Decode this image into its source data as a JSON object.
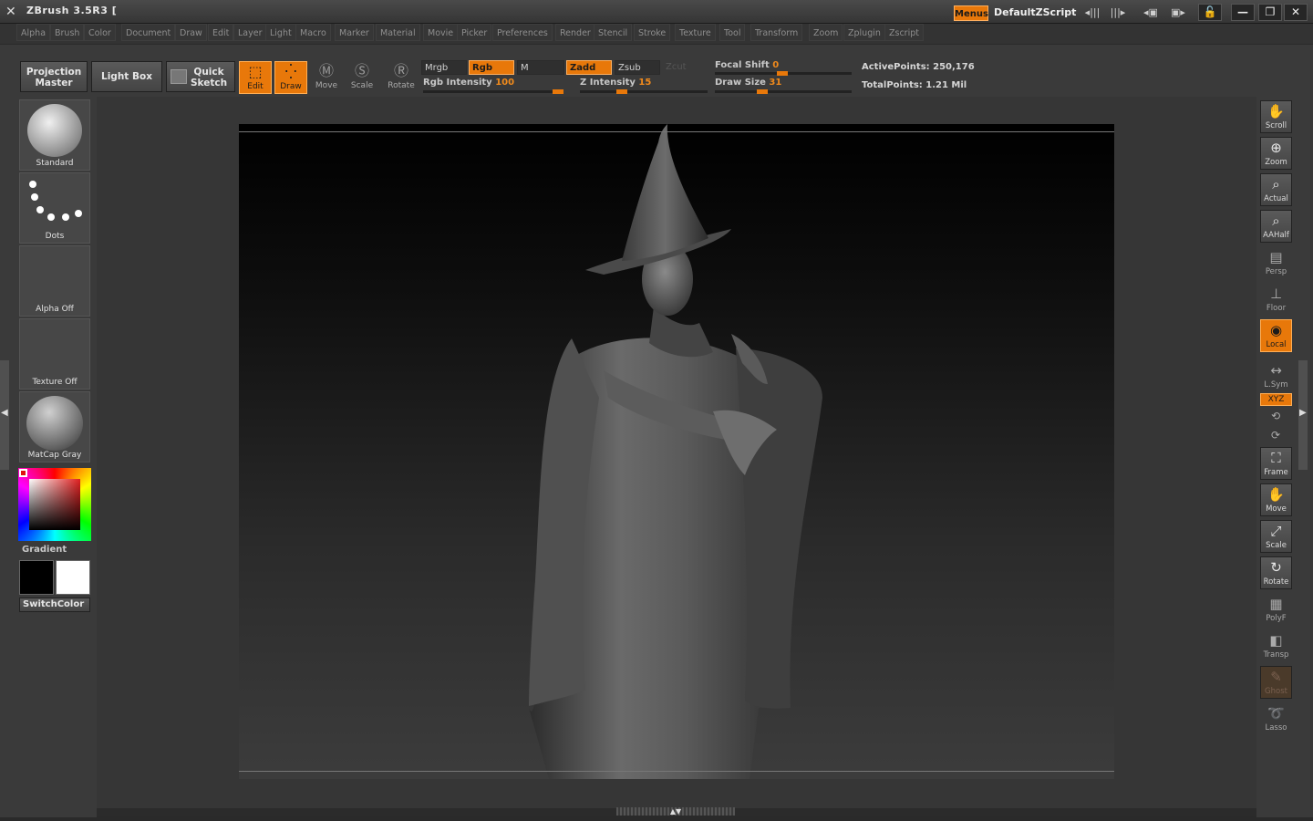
{
  "app": {
    "title": "ZBrush 3.5R3 ["
  },
  "titlebar": {
    "menus_label": "Menus",
    "script_name": "DefaultZScript"
  },
  "menubar": [
    "Alpha",
    "Brush",
    "Color",
    "Document",
    "Draw",
    "Edit",
    "Layer",
    "Light",
    "Macro",
    "Marker",
    "Material",
    "Movie",
    "Picker",
    "Preferences",
    "Render",
    "Stencil",
    "Stroke",
    "Texture",
    "Tool",
    "Transform",
    "Zoom",
    "Zplugin",
    "Zscript"
  ],
  "toolbar": {
    "projection_master_l1": "Projection",
    "projection_master_l2": "Master",
    "light_box": "Light Box",
    "quick_sketch_l1": "Quick",
    "quick_sketch_l2": "Sketch",
    "edit": "Edit",
    "draw": "Draw",
    "move": "Move",
    "scale": "Scale",
    "rotate": "Rotate",
    "mrgb": "Mrgb",
    "rgb": "Rgb",
    "m": "M",
    "zadd": "Zadd",
    "zsub": "Zsub",
    "zcut": "Zcut",
    "rgb_intensity_label": "Rgb Intensity",
    "rgb_intensity_value": "100",
    "z_intensity_label": "Z Intensity",
    "z_intensity_value": "15",
    "focal_shift_label": "Focal Shift",
    "focal_shift_value": "0",
    "draw_size_label": "Draw Size",
    "draw_size_value": "31",
    "active_points": "ActivePoints: 250,176",
    "total_points": "TotalPoints: 1.21 Mil"
  },
  "left_panel": {
    "brush_label": "Standard",
    "stroke_label": "Dots",
    "alpha_label": "Alpha Off",
    "texture_label": "Texture Off",
    "material_label": "MatCap Gray",
    "gradient_label": "Gradient",
    "switch_color_label": "SwitchColor"
  },
  "right_panel": {
    "scroll": "Scroll",
    "zoom": "Zoom",
    "actual": "Actual",
    "aahalf": "AAHalf",
    "persp": "Persp",
    "floor": "Floor",
    "local": "Local",
    "lsym": "L.Sym",
    "xyz": "XYZ",
    "frame": "Frame",
    "move": "Move",
    "scale": "Scale",
    "rotate": "Rotate",
    "polyf": "PolyF",
    "transp": "Transp",
    "ghost": "Ghost",
    "lasso": "Lasso"
  },
  "colors": {
    "accent": "#e8780a",
    "panel": "#3a3a3a",
    "canvas_top": "#000000"
  }
}
